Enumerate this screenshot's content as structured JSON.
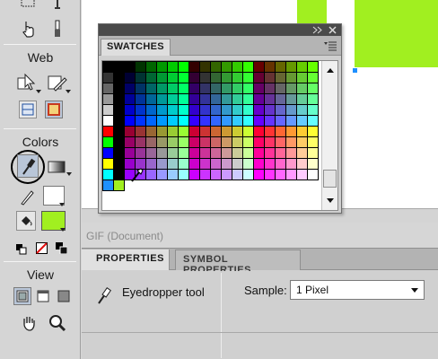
{
  "tools": {
    "web_title": "Web",
    "colors_title": "Colors",
    "view_title": "View",
    "fill_color": "#a1ef20",
    "stroke_color": "#000000"
  },
  "swatches": {
    "tab_label": "SWATCHES"
  },
  "document": {
    "label": "GIF (Document)"
  },
  "properties": {
    "tabs": [
      "PROPERTIES",
      "SYMBOL PROPERTIES"
    ],
    "tool_name": "Eyedropper tool",
    "sample_label": "Sample:",
    "sample_value": "1 Pixel"
  },
  "colors": {
    "stage_green": "#a1ef20",
    "swatch_highlight": "#1e90ff"
  }
}
